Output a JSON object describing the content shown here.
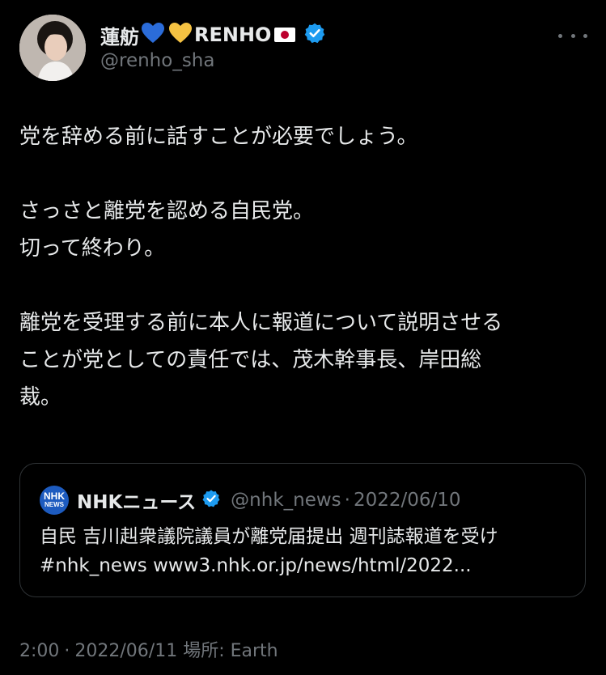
{
  "author": {
    "display_name": "蓮舫",
    "name_suffix": "RENHO",
    "handle": "@renho_sha",
    "verified": true,
    "emoji_icons": [
      "blue-heart-icon",
      "yellow-heart-icon",
      "japan-flag-icon"
    ]
  },
  "more_icon": "more-horizontal-icon",
  "tweet": {
    "paragraphs": [
      "党を辞める前に話すことが必要でしょう。",
      "さっさと離党を認める自民党。\n切って終わり。",
      "離党を受理する前に本人に報道について説明させる\nことが党としての責任では、茂木幹事長、岸田総\n裁。"
    ]
  },
  "quote": {
    "logo_line1": "NHK",
    "logo_line2": "NEWS",
    "name": "NHKニュース",
    "verified": true,
    "handle": "@nhk_news",
    "separator": "·",
    "date": "2022/06/10",
    "line1": "自民 吉川赳衆議院議員が離党届提出 週刊誌報道を受け",
    "line2": "#nhk_news www3.nhk.or.jp/news/html/2022..."
  },
  "footer": {
    "time": "2:00",
    "separator": "·",
    "date": "2022/06/11",
    "location_label": "場所: Earth"
  },
  "colors": {
    "background": "#000000",
    "text": "#e7e9ea",
    "muted": "#71767b",
    "verified_blue": "#1d9bf0",
    "border": "#2f3336"
  }
}
